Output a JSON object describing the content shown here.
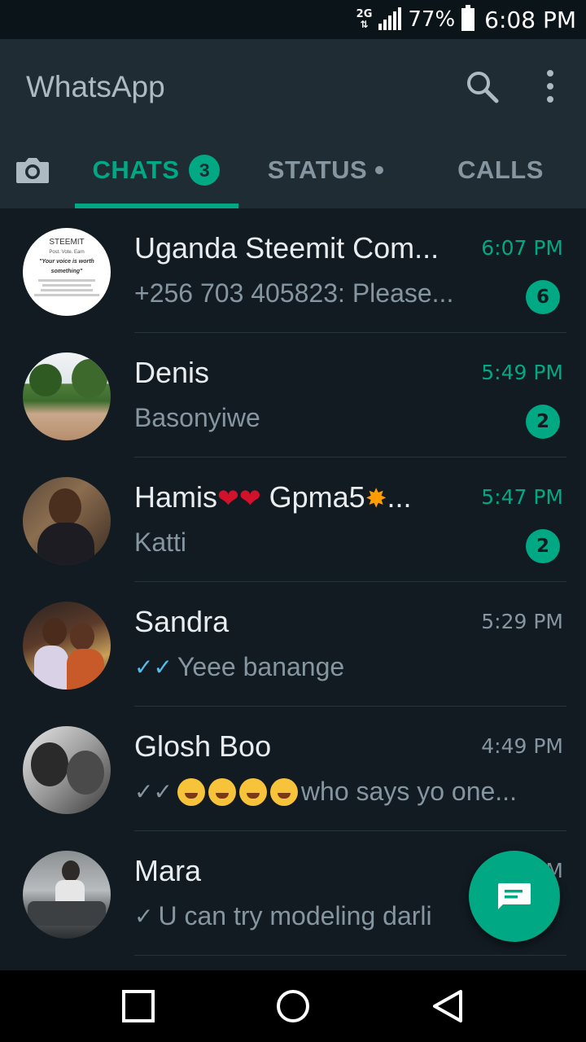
{
  "status_bar": {
    "network": "2G",
    "battery": "77%",
    "time": "6:08 PM"
  },
  "app": {
    "title": "WhatsApp"
  },
  "tabs": [
    {
      "label": "CHATS",
      "badge": "3",
      "active": true
    },
    {
      "label": "STATUS"
    },
    {
      "label": "CALLS"
    }
  ],
  "chats": [
    {
      "name": "Uganda Steemit Com...",
      "time": "6:07 PM",
      "preview": "+256 703 405823: Please...",
      "unread": "6"
    },
    {
      "name": "Denis",
      "time": "5:49 PM",
      "preview": "Basonyiwe",
      "unread": "2"
    },
    {
      "name_text": "Hamis",
      "name_mid": " Gpma5",
      "name_end": "...",
      "time": "5:47 PM",
      "preview": "Katti",
      "unread": "2"
    },
    {
      "name": "Sandra",
      "time": "5:29 PM",
      "preview": "Yeee banange",
      "tick": "read"
    },
    {
      "name": "Glosh Boo",
      "time": "4:49 PM",
      "preview": "who says yo one...",
      "tick": "delivered"
    },
    {
      "name": "Mara",
      "time": "...M",
      "preview": "U can try modeling darli",
      "tick": "sent"
    }
  ],
  "avatar_text": {
    "title": "STEEMIT",
    "line1": "Post. Vote. Earn",
    "line2": "\"Your voice is worth something\""
  },
  "colors": {
    "accent": "#00a884",
    "background": "#121b22",
    "header": "#1f2c34",
    "read_tick": "#53bdeb"
  },
  "icons": [
    "search-icon",
    "more-vert-icon",
    "camera-icon",
    "new-chat-icon",
    "recents-icon",
    "home-icon",
    "back-icon"
  ]
}
